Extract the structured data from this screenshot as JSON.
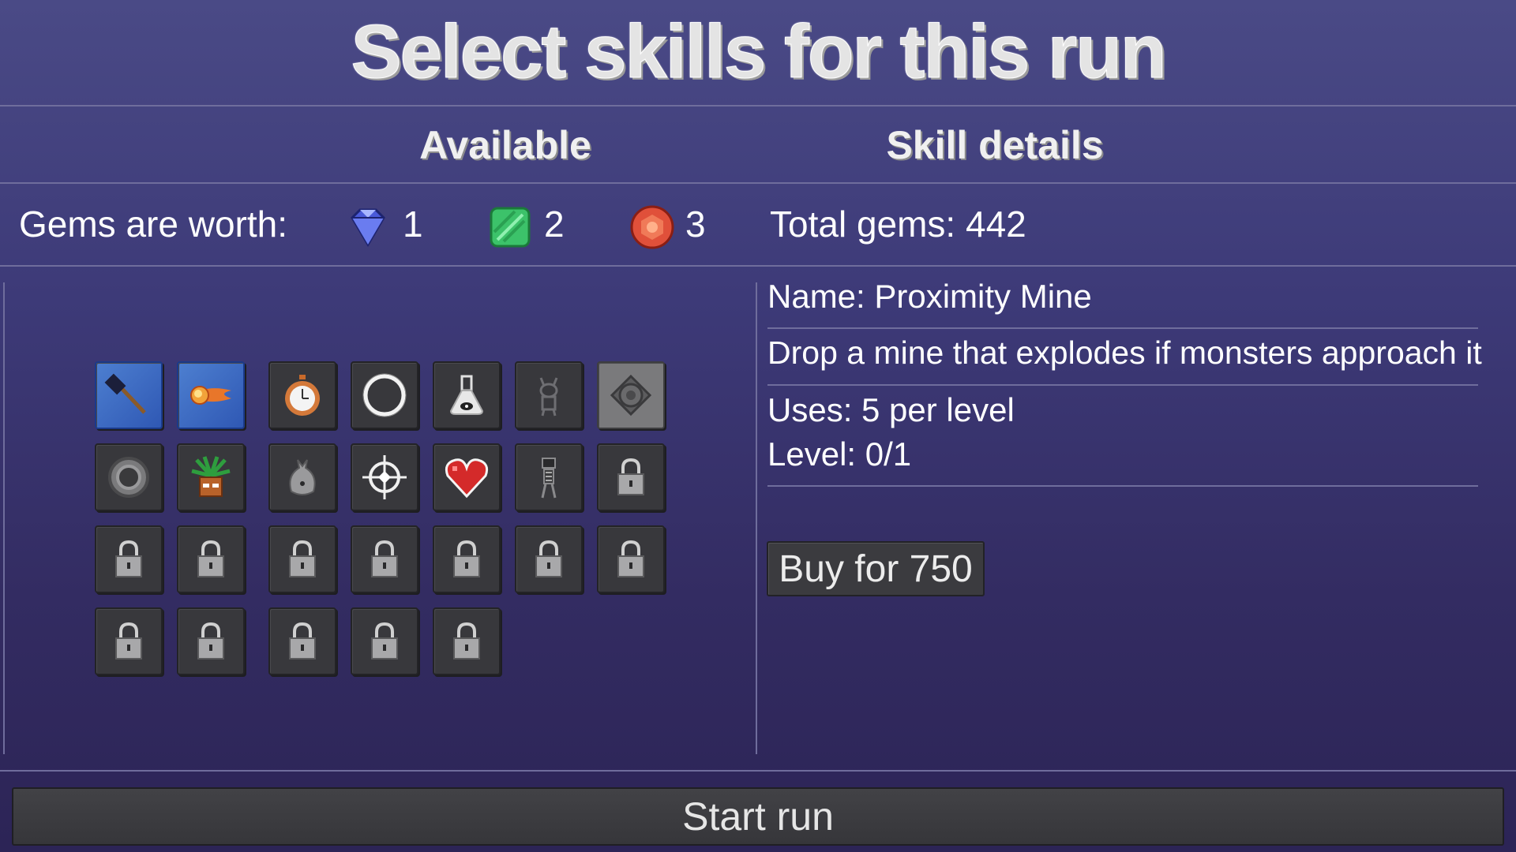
{
  "title": "Select skills for this run",
  "headers": {
    "available": "Available",
    "details": "Skill details"
  },
  "gems": {
    "label": "Gems are worth:",
    "blue": {
      "icon": "blue-diamond-gem",
      "value": "1"
    },
    "green": {
      "icon": "green-emerald-gem",
      "value": "2"
    },
    "red": {
      "icon": "red-ruby-gem",
      "value": "3"
    },
    "total": "Total gems: 442"
  },
  "skills": [
    {
      "icon": "hammer",
      "state": "selected"
    },
    {
      "icon": "fireball",
      "state": "selected"
    },
    {
      "icon": "stopwatch",
      "state": "owned"
    },
    {
      "icon": "ring",
      "state": "owned"
    },
    {
      "icon": "potion-flask",
      "state": "owned"
    },
    {
      "icon": "ghost-creature",
      "state": "owned"
    },
    {
      "icon": "proximity-mine",
      "state": "highlighted"
    },
    {
      "icon": "shield-ring",
      "state": "owned"
    },
    {
      "icon": "potted-plant",
      "state": "owned"
    },
    {
      "icon": "grey-sack",
      "state": "owned"
    },
    {
      "icon": "crosshair",
      "state": "owned"
    },
    {
      "icon": "heart",
      "state": "owned"
    },
    {
      "icon": "skeleton",
      "state": "owned"
    },
    {
      "icon": "padlock",
      "state": "locked"
    },
    {
      "icon": "padlock",
      "state": "locked"
    },
    {
      "icon": "padlock",
      "state": "locked"
    },
    {
      "icon": "padlock",
      "state": "locked"
    },
    {
      "icon": "padlock",
      "state": "locked"
    },
    {
      "icon": "padlock",
      "state": "locked"
    },
    {
      "icon": "padlock",
      "state": "locked"
    },
    {
      "icon": "padlock",
      "state": "locked"
    },
    {
      "icon": "padlock",
      "state": "locked"
    },
    {
      "icon": "padlock",
      "state": "locked"
    },
    {
      "icon": "padlock",
      "state": "locked"
    },
    {
      "icon": "padlock",
      "state": "locked"
    },
    {
      "icon": "padlock",
      "state": "locked"
    }
  ],
  "details": {
    "name": "Name: Proximity Mine",
    "description": "Drop a mine that explodes if monsters approach it",
    "uses": "Uses: 5 per level",
    "level": "Level: 0/1",
    "buy_label": "Buy for 750"
  },
  "start_label": "Start run",
  "colors": {
    "selected": "#3f6cc4",
    "slot": "#38383c",
    "highlight": "#7a7a7c",
    "background": "#3d3a78"
  }
}
